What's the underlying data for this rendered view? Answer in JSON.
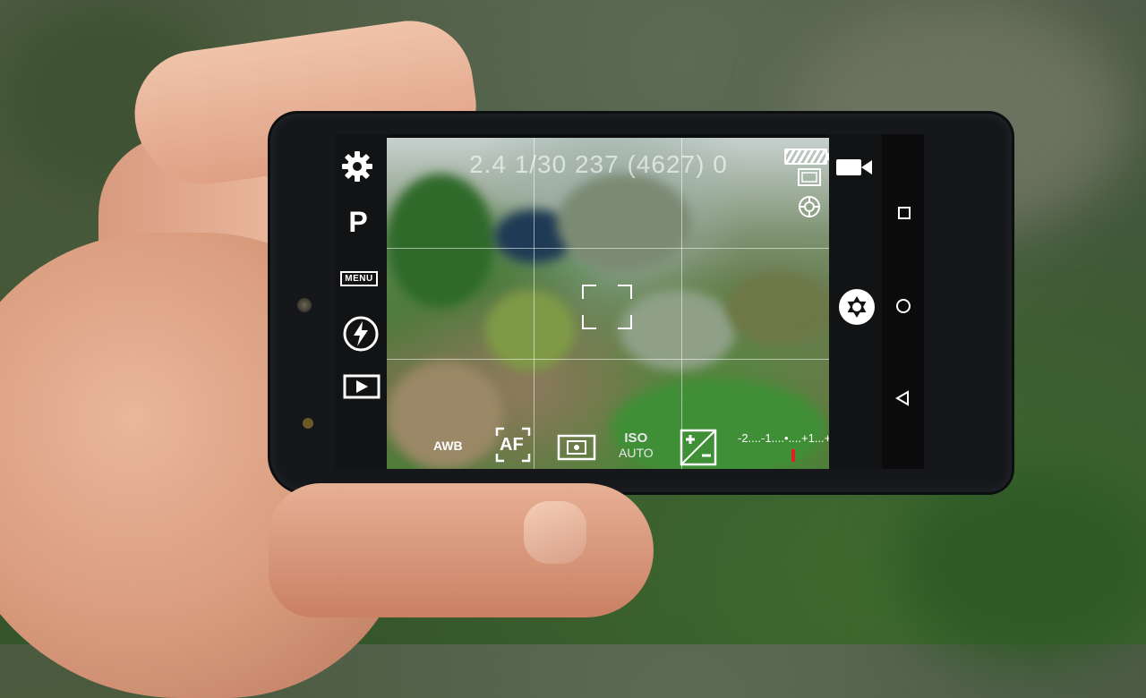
{
  "camera": {
    "status_line": "2.4  1/30  237 (4627)  0",
    "mode_label": "P",
    "menu_label": "MENU",
    "bottom": {
      "awb_label": "AWB",
      "af_label": "AF",
      "iso_label": "ISO",
      "iso_value": "AUTO",
      "ev_scale": "-2....-1....•....+1...+2"
    }
  },
  "icons": {
    "settings": "gear-icon",
    "flash": "flash-auto-icon",
    "play": "playback-icon",
    "video": "video-camera-icon",
    "shutter": "shutter-icon",
    "metering": "metering-icon",
    "ev": "exposure-compensation-icon",
    "battery": "battery-icon",
    "resolution": "resolution-icon",
    "stabilization": "stabilization-icon",
    "recent_apps": "square-nav-icon",
    "home": "circle-nav-icon",
    "back": "triangle-back-icon"
  },
  "colors": {
    "ui_text": "#ffffff",
    "ev_marker": "#e02020",
    "phone_body": "#15171a"
  }
}
